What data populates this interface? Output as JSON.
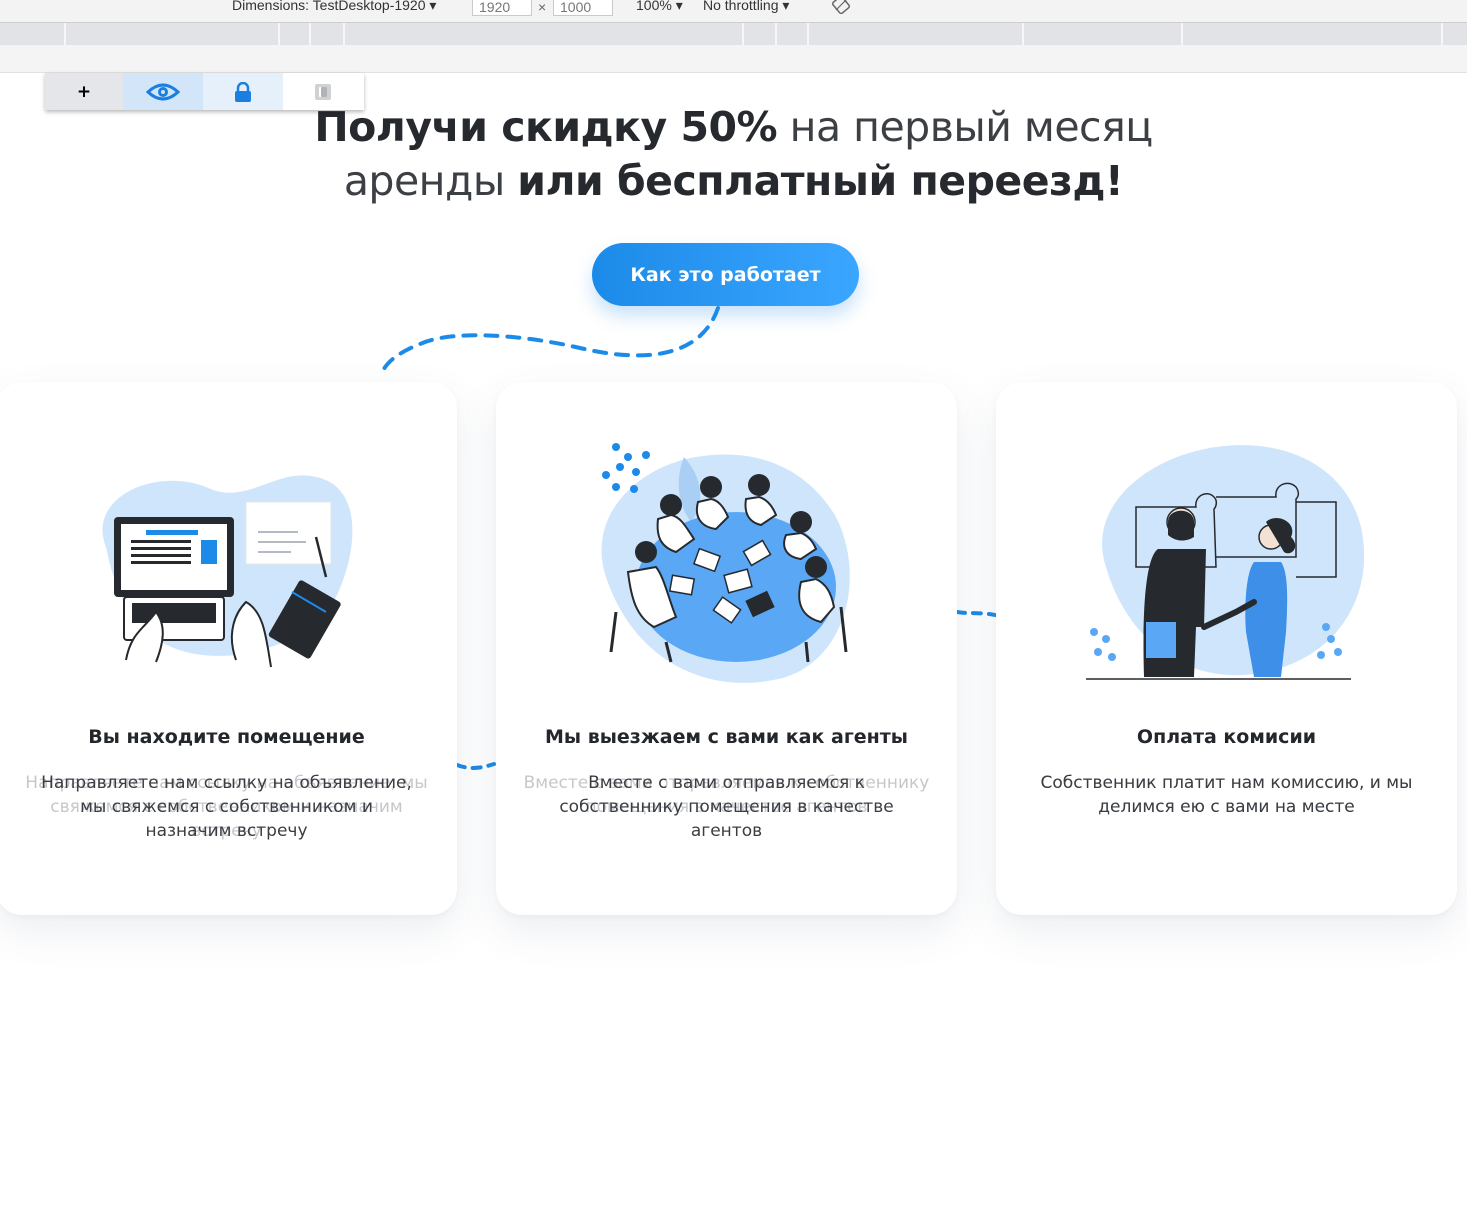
{
  "devtools": {
    "dimensions_label": "Dimensions: TestDesktop-1920 ▾",
    "width_value": "1920",
    "height_value": "1000",
    "times_sign": "×",
    "zoom_label": "100% ▾",
    "throttle_label": "No throttling ▾"
  },
  "palette": {
    "add_label": "+",
    "icons": [
      "add-icon",
      "eye-icon",
      "lock-icon",
      "frame-icon"
    ],
    "accent": "#1a7fe0"
  },
  "hero": {
    "headline_bold_1": "Получи скидку 50%",
    "headline_light_1": " на первый месяц",
    "headline_light_2": "аренды ",
    "headline_bold_2": "или бесплатный переезд!",
    "cta_label": "Как это работает"
  },
  "cards": [
    {
      "title": "Вы находите помещение",
      "text": "Направляете нам ссылку на объявление, мы свяжемся с собственником и назначим встречу",
      "ghost_text": "Направляете нам ссылку на объявление, мы свяжемся с собственником и назначим встречу",
      "icon": "laptop-illustration"
    },
    {
      "title": "Мы выезжаем с вами как агенты",
      "text": "Вместе с вами отправляемся к собственнику помещения в качестве агентов",
      "ghost_text": "Вместе с вами отправляемся к собственнику помещения в качестве агентов",
      "icon": "meeting-illustration"
    },
    {
      "title": "Оплата комисии",
      "text": "Собственник платит нам комиссию, и мы делимся ею с вами на месте",
      "ghost_text": "Собственник платит нам комиссию, и мы делимся ею с вами на месте",
      "icon": "handshake-illustration"
    }
  ],
  "colors": {
    "brand_blue": "#1c8ae8",
    "light_blue": "#cfe5fb",
    "dark": "#26292e"
  }
}
